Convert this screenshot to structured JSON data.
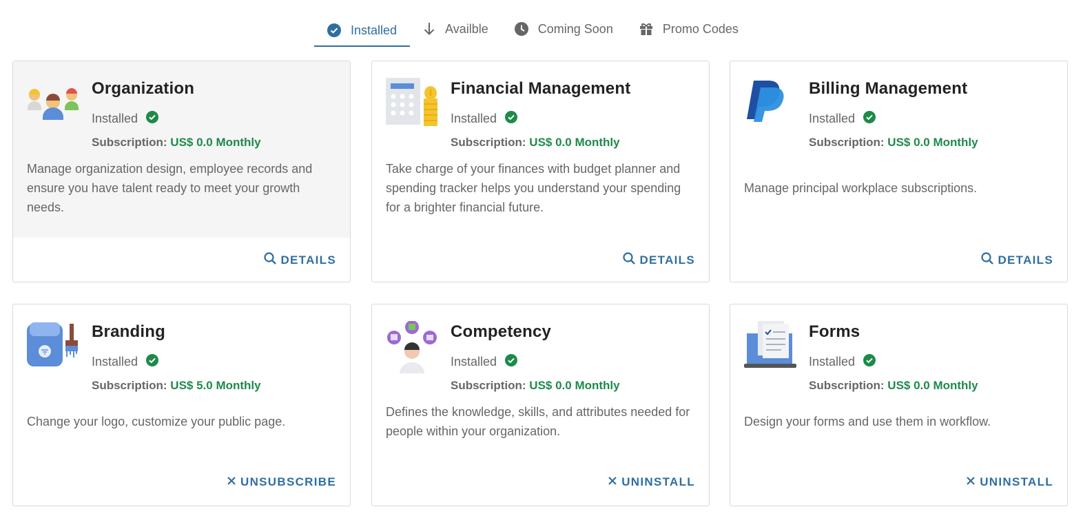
{
  "tabs": [
    {
      "label": "Installed",
      "icon": "check-circle-icon",
      "active": true
    },
    {
      "label": "Availble",
      "icon": "arrow-down-icon",
      "active": false
    },
    {
      "label": "Coming Soon",
      "icon": "clock-icon",
      "active": false
    },
    {
      "label": "Promo Codes",
      "icon": "gift-icon",
      "active": false
    }
  ],
  "colors": {
    "accent": "#2f6ea1",
    "success": "#1e8a4a",
    "muted": "#666666"
  },
  "cards": [
    {
      "title": "Organization",
      "status": "Installed",
      "subscription_label": "Subscription:",
      "price": "US$ 0.0 Monthly",
      "description": "Manage organization design, employee records and ensure you have talent ready to meet your growth needs.",
      "action": "DETAILS",
      "action_icon": "search-icon",
      "logo": "people-group-icon"
    },
    {
      "title": "Financial Management",
      "status": "Installed",
      "subscription_label": "Subscription:",
      "price": "US$ 0.0 Monthly",
      "description": "Take charge of your finances with budget planner and spending tracker helps you understand your spending for a brighter financial future.",
      "action": "DETAILS",
      "action_icon": "search-icon",
      "logo": "calculator-coins-icon"
    },
    {
      "title": "Billing Management",
      "status": "Installed",
      "subscription_label": "Subscription:",
      "price": "US$ 0.0 Monthly",
      "description": "Manage principal workplace subscriptions.",
      "action": "DETAILS",
      "action_icon": "search-icon",
      "logo": "paypal-icon"
    },
    {
      "title": "Branding",
      "status": "Installed",
      "subscription_label": "Subscription:",
      "price": "US$ 5.0 Monthly",
      "description": "Change your logo, customize your public page.",
      "action": "UNSUBSCRIBE",
      "action_icon": "close-icon",
      "logo": "paint-bucket-brush-icon"
    },
    {
      "title": "Competency",
      "status": "Installed",
      "subscription_label": "Subscription:",
      "price": "US$ 0.0 Monthly",
      "description": "Defines the knowledge, skills, and attributes needed for people within your organization.",
      "action": "UNINSTALL",
      "action_icon": "close-icon",
      "logo": "person-skills-icon"
    },
    {
      "title": "Forms",
      "status": "Installed",
      "subscription_label": "Subscription:",
      "price": "US$ 0.0 Monthly",
      "description": "Design your forms and use them in workflow.",
      "action": "UNINSTALL",
      "action_icon": "close-icon",
      "logo": "laptop-form-icon"
    }
  ]
}
